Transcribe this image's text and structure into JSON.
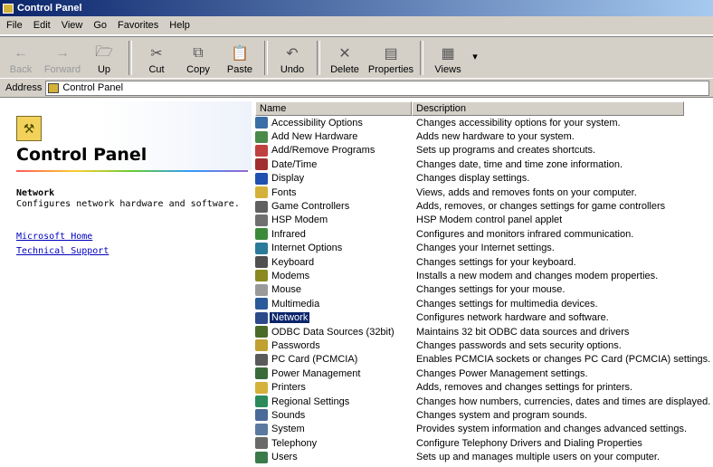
{
  "window": {
    "title": "Control Panel"
  },
  "menu": [
    "File",
    "Edit",
    "View",
    "Go",
    "Favorites",
    "Help"
  ],
  "toolbar": [
    {
      "label": "Back",
      "icon": "back-arrow-icon",
      "disabled": true
    },
    {
      "label": "Forward",
      "icon": "forward-arrow-icon",
      "disabled": true
    },
    {
      "label": "Up",
      "icon": "up-folder-icon",
      "disabled": false
    },
    {
      "label": "Cut",
      "icon": "scissors-icon",
      "disabled": false
    },
    {
      "label": "Copy",
      "icon": "copy-icon",
      "disabled": false
    },
    {
      "label": "Paste",
      "icon": "paste-icon",
      "disabled": false
    },
    {
      "label": "Undo",
      "icon": "undo-icon",
      "disabled": false
    },
    {
      "label": "Delete",
      "icon": "delete-x-icon",
      "disabled": false
    },
    {
      "label": "Properties",
      "icon": "properties-icon",
      "disabled": false
    },
    {
      "label": "Views",
      "icon": "views-icon",
      "disabled": false
    }
  ],
  "address": {
    "label": "Address",
    "value": "Control Panel"
  },
  "left": {
    "title": "Control Panel",
    "selected_name": "Network",
    "selected_desc": "Configures network hardware and software.",
    "links": [
      "Microsoft Home",
      "Technical Support"
    ]
  },
  "list": {
    "columns": [
      "Name",
      "Description"
    ],
    "selected_index": 14,
    "items": [
      {
        "name": "Accessibility Options",
        "desc": "Changes accessibility options for your system.",
        "icon": "accessibility-icon",
        "color": "#3a6ea5"
      },
      {
        "name": "Add New Hardware",
        "desc": "Adds new hardware to your system.",
        "icon": "hardware-icon",
        "color": "#4a8a4a"
      },
      {
        "name": "Add/Remove Programs",
        "desc": "Sets up programs and creates shortcuts.",
        "icon": "programs-icon",
        "color": "#c04040"
      },
      {
        "name": "Date/Time",
        "desc": "Changes date, time and time zone information.",
        "icon": "clock-icon",
        "color": "#a03030"
      },
      {
        "name": "Display",
        "desc": "Changes display settings.",
        "icon": "monitor-icon",
        "color": "#2050b0"
      },
      {
        "name": "Fonts",
        "desc": "Views, adds and removes fonts on your computer.",
        "icon": "fonts-icon",
        "color": "#d4b23a"
      },
      {
        "name": "Game Controllers",
        "desc": "Adds, removes, or changes settings for game controllers",
        "icon": "joystick-icon",
        "color": "#606060"
      },
      {
        "name": "HSP Modem",
        "desc": "HSP Modem control panel applet",
        "icon": "modem-tool-icon",
        "color": "#707070"
      },
      {
        "name": "Infrared",
        "desc": "Configures and monitors infrared communication.",
        "icon": "infrared-icon",
        "color": "#3a8a3a"
      },
      {
        "name": "Internet Options",
        "desc": "Changes your Internet settings.",
        "icon": "globe-icon",
        "color": "#2a7a9a"
      },
      {
        "name": "Keyboard",
        "desc": "Changes settings for your keyboard.",
        "icon": "keyboard-icon",
        "color": "#505050"
      },
      {
        "name": "Modems",
        "desc": "Installs a new modem and changes modem properties.",
        "icon": "modem-icon",
        "color": "#8a8a20"
      },
      {
        "name": "Mouse",
        "desc": "Changes settings for your mouse.",
        "icon": "mouse-icon",
        "color": "#9a9a9a"
      },
      {
        "name": "Multimedia",
        "desc": "Changes settings for multimedia devices.",
        "icon": "multimedia-icon",
        "color": "#2a5a9a"
      },
      {
        "name": "Network",
        "desc": "Configures network hardware and software.",
        "icon": "network-icon",
        "color": "#2a4a8a"
      },
      {
        "name": "ODBC Data Sources (32bit)",
        "desc": "Maintains 32 bit ODBC data sources and drivers",
        "icon": "database-icon",
        "color": "#4a6a2a"
      },
      {
        "name": "Passwords",
        "desc": "Changes passwords and sets security options.",
        "icon": "keys-icon",
        "color": "#c0a030"
      },
      {
        "name": "PC Card (PCMCIA)",
        "desc": "Enables PCMCIA sockets or changes PC Card (PCMCIA) settings.",
        "icon": "pc-card-icon",
        "color": "#5a5a5a"
      },
      {
        "name": "Power Management",
        "desc": "Changes Power Management settings.",
        "icon": "power-icon",
        "color": "#3a6a3a"
      },
      {
        "name": "Printers",
        "desc": "Adds, removes and changes settings for printers.",
        "icon": "printer-icon",
        "color": "#d4b23a"
      },
      {
        "name": "Regional Settings",
        "desc": "Changes how numbers, currencies, dates and times are displayed.",
        "icon": "globe-regional-icon",
        "color": "#2a8a5a"
      },
      {
        "name": "Sounds",
        "desc": "Changes system and program sounds.",
        "icon": "speaker-icon",
        "color": "#4a6a9a"
      },
      {
        "name": "System",
        "desc": "Provides system information and changes advanced settings.",
        "icon": "computer-icon",
        "color": "#5a7aa0"
      },
      {
        "name": "Telephony",
        "desc": "Configure Telephony Drivers and Dialing Properties",
        "icon": "telephone-icon",
        "color": "#6a6a6a"
      },
      {
        "name": "Users",
        "desc": "Sets up and manages multiple users on your computer.",
        "icon": "users-icon",
        "color": "#3a7a4a"
      }
    ]
  }
}
